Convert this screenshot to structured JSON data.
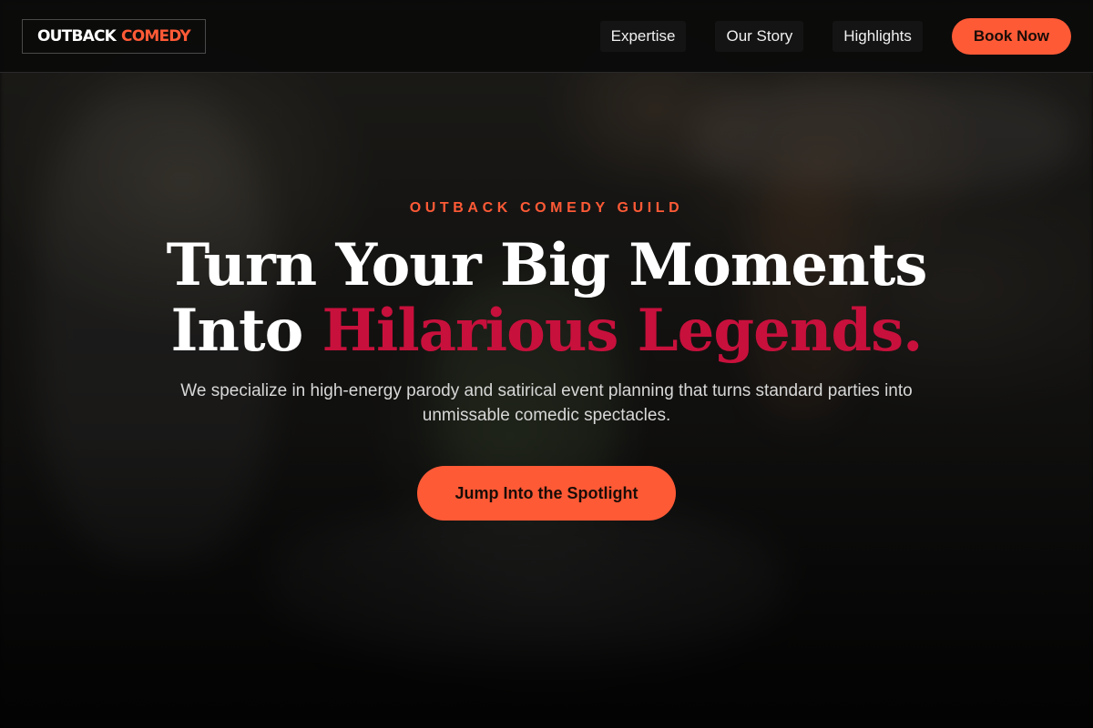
{
  "header": {
    "logo": {
      "part1": "OUTBACK",
      "part2": "COMEDY"
    },
    "nav": [
      {
        "label": "Expertise"
      },
      {
        "label": "Our Story"
      },
      {
        "label": "Highlights"
      }
    ],
    "cta_label": "Book Now"
  },
  "hero": {
    "eyebrow": "OUTBACK COMEDY GUILD",
    "headline_line1": "Turn Your Big Moments",
    "headline_line2_plain": "Into",
    "headline_line2_accent": "Hilarious Legends.",
    "subtext": "We specialize in high-energy parody and satirical event planning that turns standard parties into unmissable comedic spectacles.",
    "cta_label": "Jump Into the Spotlight"
  },
  "colors": {
    "accent_orange": "#ff5a36",
    "accent_crimson": "#c8103c",
    "header_bg": "#0a0a0a"
  }
}
